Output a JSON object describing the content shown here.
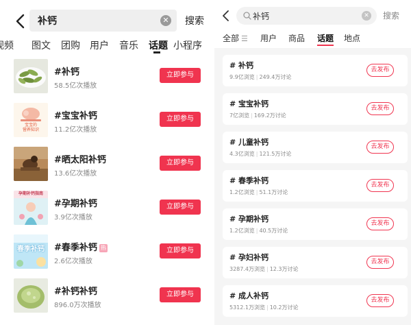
{
  "left": {
    "search": {
      "query": "补钙",
      "button": "搜索"
    },
    "tabs": [
      "视频",
      "图文",
      "团购",
      "用户",
      "音乐",
      "话题",
      "小程序"
    ],
    "active_tab": "话题",
    "join_label": "立即参与",
    "items": [
      {
        "title": "#补钙",
        "plays": "58.5亿次播放",
        "thumb": "green-vegetable",
        "badge": ""
      },
      {
        "title": "#宝宝补钙",
        "plays": "11.2亿次播放",
        "thumb": "baby-illustration",
        "badge": ""
      },
      {
        "title": "#晒太阳补钙",
        "plays": "13.6亿次播放",
        "thumb": "sunbathing-photo",
        "badge": ""
      },
      {
        "title": "#孕期补钙",
        "plays": "3.9亿次播放",
        "thumb": "pregnancy-illustration",
        "badge": ""
      },
      {
        "title": "#春季补钙",
        "plays": "2.6亿次播放",
        "thumb": "spring-banner",
        "badge": "热"
      },
      {
        "title": "#补钙补钙",
        "plays": "896.0万次播放",
        "thumb": "green-drink",
        "badge": ""
      }
    ],
    "thumb_texts": {
      "baby": "宝宝的\n营养知识",
      "pregnancy": "孕期补钙指南",
      "spring": "春季补钙"
    }
  },
  "right": {
    "search": {
      "query": "补钙",
      "button": "搜索"
    },
    "tabs": [
      "全部",
      "用户",
      "商品",
      "话题",
      "地点"
    ],
    "active_tab": "话题",
    "publish_label": "去发布",
    "items": [
      {
        "title": "# 补钙",
        "views": "9.9亿浏览",
        "discuss": "249.4万讨论"
      },
      {
        "title": "# 宝宝补钙",
        "views": "7亿浏览",
        "discuss": "169.2万讨论"
      },
      {
        "title": "# 儿童补钙",
        "views": "4.3亿浏览",
        "discuss": "121.5万讨论"
      },
      {
        "title": "# 春季补钙",
        "views": "1.2亿浏览",
        "discuss": "51.1万讨论"
      },
      {
        "title": "# 孕期补钙",
        "views": "1.2亿浏览",
        "discuss": "40.5万讨论"
      },
      {
        "title": "# 孕妇补钙",
        "views": "3287.4万浏览",
        "discuss": "12.3万讨论"
      },
      {
        "title": "# 成人补钙",
        "views": "5312.1万浏览",
        "discuss": "10.2万讨论"
      }
    ]
  },
  "colors": {
    "accent": "#f0344f",
    "right_bg": "#f5f5f5",
    "search_bg": "#efefef"
  }
}
